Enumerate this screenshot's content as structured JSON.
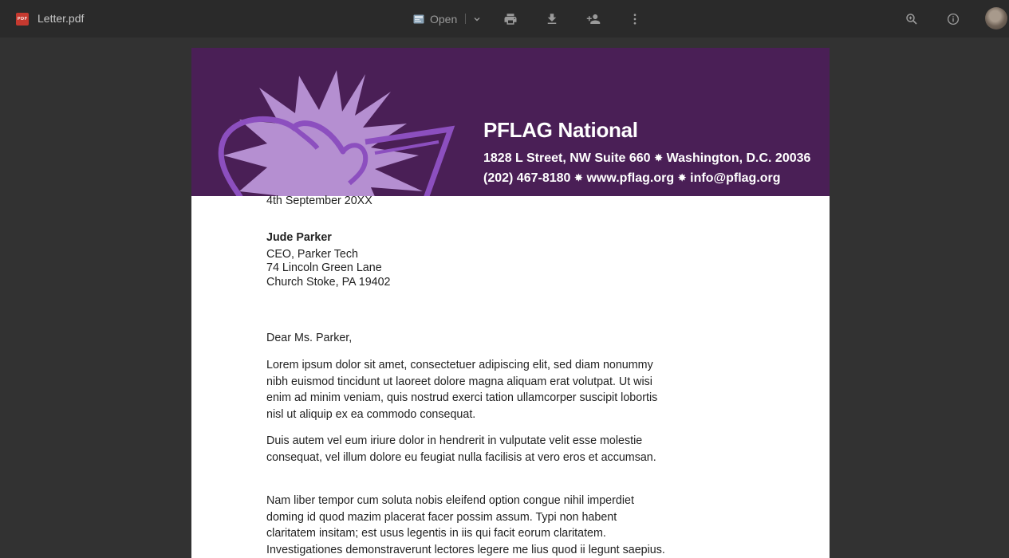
{
  "toolbar": {
    "file_icon_label": "PDF",
    "file_name": "Letter.pdf",
    "open_label": "Open",
    "print_icon": "print-icon",
    "download_icon": "download-icon",
    "share_icon": "add-person-icon",
    "more_icon": "more-vert-icon",
    "zoom_icon": "zoom-in-icon",
    "info_icon": "info-icon"
  },
  "letterhead": {
    "org_name": "PFLAG National",
    "address_part1": "1828 L Street, NW Suite 660",
    "address_part2": "Washington, D.C. 20036",
    "phone": "(202) 467-8180",
    "website": "www.pflag.org",
    "email": "info@pflag.org",
    "separator": "✸",
    "brand_color": "#4a1f56",
    "logo_fill": "#b58fd1",
    "logo_stroke": "#8c4fbf"
  },
  "letter": {
    "date": "4th September 20XX",
    "recipient_name": "Jude Parker",
    "recipient_title": "CEO, Parker Tech",
    "recipient_street": "74 Lincoln Green Lane",
    "recipient_city": "Church Stoke, PA 19402",
    "salutation": "Dear Ms. Parker,",
    "paragraph1": "Lorem ipsum dolor sit amet, consectetuer adipiscing elit, sed diam nonummy nibh euismod tincidunt ut laoreet dolore magna aliquam erat volutpat. Ut wisi enim ad minim veniam, quis nostrud exerci tation ullamcorper suscipit lobortis nisl ut aliquip ex ea commodo consequat.",
    "paragraph2": "Duis autem vel eum iriure dolor in hendrerit in vulputate velit esse molestie consequat, vel illum dolore eu feugiat nulla facilisis at vero eros et accumsan.",
    "paragraph3": "Nam liber tempor cum soluta nobis eleifend option congue nihil imperdiet doming id quod mazim placerat facer possim assum. Typi non habent claritatem insitam; est usus legentis in iis qui facit eorum claritatem. Investigationes demonstraverunt lectores legere me lius quod ii legunt saepius."
  }
}
